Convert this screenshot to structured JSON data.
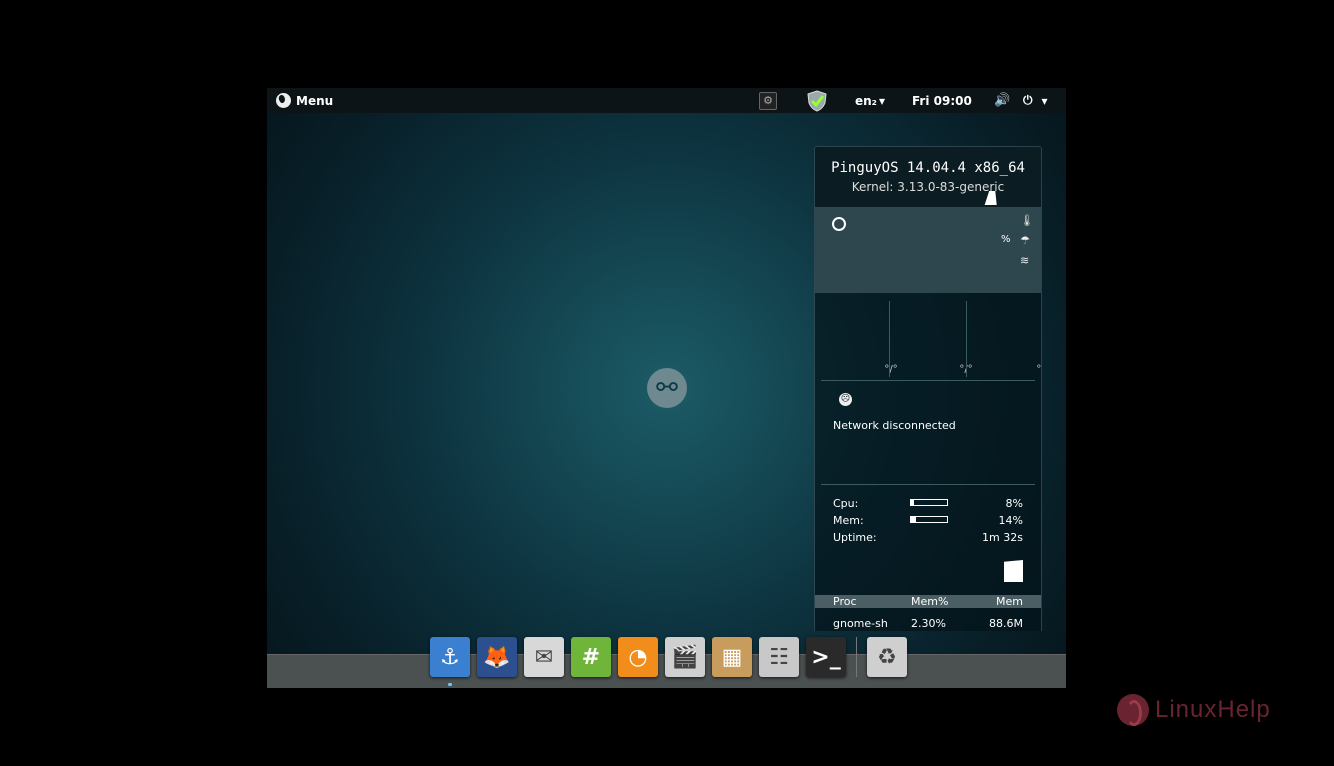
{
  "topbar": {
    "menu_label": "Menu",
    "settings_glyph": "⚙",
    "shield_glyph": "✔",
    "lang": "en₂",
    "lang_caret": "▾",
    "clock": "Fri 09:00",
    "volume_glyph": "🔊",
    "power_glyph": "⏻",
    "power_caret": "▾"
  },
  "conky": {
    "os_title": "PinguyOS 14.04.4 x86_64",
    "kernel": "Kernel: 3.13.0-83-generic",
    "weather": {
      "percent": "%",
      "icons": [
        "thermometer-icon",
        "umbrella-icon",
        "wind-icon"
      ],
      "glyphs": [
        "🌡",
        "☂",
        "≋"
      ]
    },
    "temps": [
      "°/°",
      "°/°",
      "°/°"
    ],
    "network": {
      "icon_glyph": "☹",
      "status": "Network disconnected"
    },
    "stats": {
      "cpu_label": "Cpu:",
      "cpu_value": "8%",
      "cpu_fraction": 0.08,
      "mem_label": "Mem:",
      "mem_value": "14%",
      "mem_fraction": 0.14,
      "uptime_label": "Uptime:",
      "uptime_value": "1m 32s"
    },
    "proc_headers": [
      "Proc",
      "Mem%",
      "Mem"
    ],
    "proc_rows": [
      {
        "name": "gnome-sh",
        "mem_pct": "2.30%",
        "mem": "88.6M"
      }
    ]
  },
  "dock": {
    "items": [
      {
        "name": "anchor",
        "glyph": "⚓",
        "color": "#3a7fd0"
      },
      {
        "name": "firefox",
        "glyph": "🦊",
        "color": "#2c4f8f"
      },
      {
        "name": "thunderbird",
        "glyph": "✉",
        "color": "#d8d8d8"
      },
      {
        "name": "hashtag",
        "glyph": "#",
        "color": "#6fb53a"
      },
      {
        "name": "orange",
        "glyph": "◔",
        "color": "#f28c1a"
      },
      {
        "name": "clapper",
        "glyph": "🎬",
        "color": "#cfcfcf"
      },
      {
        "name": "archive",
        "glyph": "▦",
        "color": "#c89c5c"
      },
      {
        "name": "mixer",
        "glyph": "☷",
        "color": "#c8c8c8"
      },
      {
        "name": "terminal",
        "glyph": ">_",
        "color": "#2a2a2a"
      },
      {
        "name": "trash",
        "glyph": "♻",
        "color": "#cfcfcf"
      }
    ]
  },
  "center_logo_glyph": "⚯",
  "watermark": {
    "text": "LinuxHelp"
  }
}
